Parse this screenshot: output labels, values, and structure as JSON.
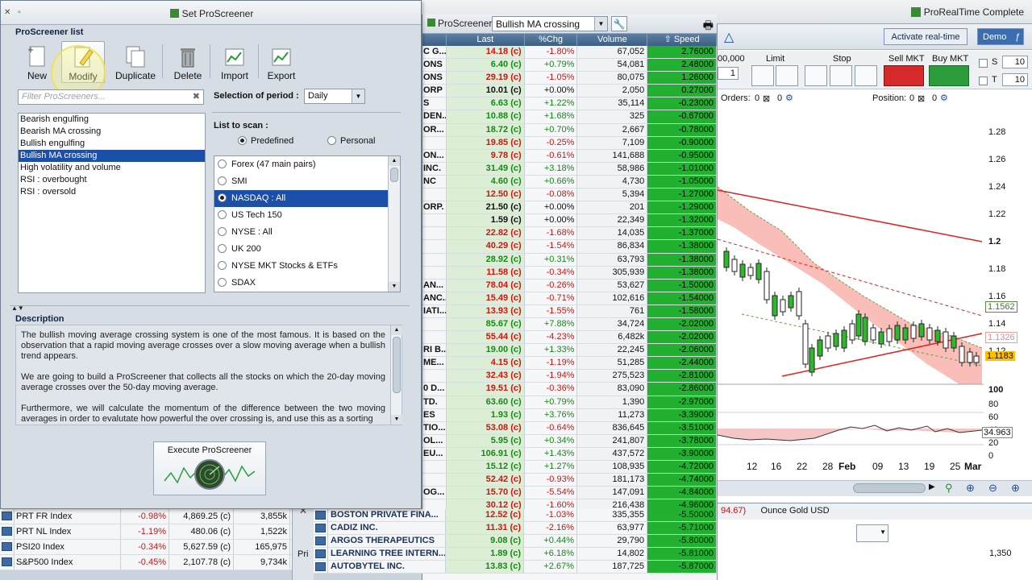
{
  "app": {
    "title": "ProRealTime Complete"
  },
  "dialog": {
    "title": "Set ProScreener",
    "list_section": "ProScreener list",
    "toolbar": [
      {
        "label": "New",
        "icon": "new-document-icon"
      },
      {
        "label": "Modify",
        "icon": "pencil-icon"
      },
      {
        "label": "Duplicate",
        "icon": "duplicate-icon"
      },
      {
        "label": "Delete",
        "icon": "trash-icon"
      },
      {
        "label": "Import",
        "icon": "import-icon"
      },
      {
        "label": "Export",
        "icon": "export-icon"
      }
    ],
    "filter_placeholder": "Filter ProScreeners...",
    "screeners": [
      "Bearish engulfing",
      "Bearish MA crossing",
      "Bullish engulfing",
      "Bullish MA crossing",
      "High volatility and volume",
      "RSI : overbought",
      "RSI : oversold"
    ],
    "selected_screener": "Bullish MA crossing",
    "period_label": "Selection of period :",
    "period_value": "Daily",
    "list_to_scan_label": "List to scan :",
    "scan_type": {
      "predefined": "Predefined",
      "personal": "Personal",
      "selected": "Predefined"
    },
    "scan_lists": [
      "Forex (47 main pairs)",
      "SMI",
      "NASDAQ : All",
      "US Tech 150",
      "NYSE : All",
      "UK 200",
      "NYSE MKT Stocks & ETFs",
      "SDAX"
    ],
    "selected_scan_list": "NASDAQ : All",
    "description_label": "Description",
    "description": [
      "The bullish moving average crossing system is one of the most famous. It is based on the observation that a rapid moving average crosses over a slow moving average when a bullish trend appears.",
      "We are going to build a ProScreener that collects all the stocks on which the 20-day moving average crosses over the 50-day moving average.",
      "Furthermore, we will calculate the momentum of the difference between the two moving averages in order to evalutate how powerful the over crossing is, and use this as a sorting"
    ],
    "execute_label": "Execute ProScreener"
  },
  "results": {
    "title": "ProScreener",
    "screener": "Bullish MA crossing",
    "columns": [
      "Last",
      "%Chg",
      "Volume",
      "Speed"
    ],
    "rows": [
      [
        "C G...",
        "14.18 (c)",
        "-1.80%",
        "67,052",
        "2.76000"
      ],
      [
        "ONS",
        "6.40 (c)",
        "+0.79%",
        "54,081",
        "2.48000"
      ],
      [
        "ONS",
        "29.19 (c)",
        "-1.05%",
        "80,075",
        "1.26000"
      ],
      [
        "ORP",
        "10.01 (c)",
        "+0.00%",
        "2,050",
        "0.27000"
      ],
      [
        "S",
        "6.63 (c)",
        "+1.22%",
        "35,114",
        "-0.23000"
      ],
      [
        "DEN...",
        "10.88 (c)",
        "+1.68%",
        "325",
        "-0.67000"
      ],
      [
        "OR...",
        "18.72 (c)",
        "+0.70%",
        "2,667",
        "-0.78000"
      ],
      [
        "",
        "19.85 (c)",
        "-0.25%",
        "7,109",
        "-0.90000"
      ],
      [
        "ON...",
        "9.78 (c)",
        "-0.61%",
        "141,688",
        "-0.95000"
      ],
      [
        "INC.",
        "31.49 (c)",
        "+3.18%",
        "58,986",
        "-1.01000"
      ],
      [
        "NC",
        "4.60 (c)",
        "+0.66%",
        "4,730",
        "-1.05000"
      ],
      [
        "",
        "12.50 (c)",
        "-0.08%",
        "5,394",
        "-1.27000"
      ],
      [
        "ORP.",
        "21.50 (c)",
        "+0.00%",
        "201",
        "-1.29000"
      ],
      [
        "",
        "1.59 (c)",
        "+0.00%",
        "22,349",
        "-1.32000"
      ],
      [
        "",
        "22.82 (c)",
        "-1.68%",
        "14,035",
        "-1.37000"
      ],
      [
        "",
        "40.29 (c)",
        "-1.54%",
        "86,834",
        "-1.38000"
      ],
      [
        "",
        "28.92 (c)",
        "+0.31%",
        "63,793",
        "-1.38000"
      ],
      [
        "",
        "11.58 (c)",
        "-0.34%",
        "305,939",
        "-1.38000"
      ],
      [
        "AN...",
        "78.04 (c)",
        "-0.26%",
        "53,627",
        "-1.50000"
      ],
      [
        "ANC...",
        "15.49 (c)",
        "-0.71%",
        "102,616",
        "-1.54000"
      ],
      [
        "IATI...",
        "13.93 (c)",
        "-1.55%",
        "761",
        "-1.58000"
      ],
      [
        "",
        "85.67 (c)",
        "+7.88%",
        "34,724",
        "-2.02000"
      ],
      [
        "",
        "55.44 (c)",
        "-4.23%",
        "6,482k",
        "-2.02000"
      ],
      [
        "RI B...",
        "19.00 (c)",
        "+1.33%",
        "22,245",
        "-2.06000"
      ],
      [
        "ME...",
        "4.15 (c)",
        "-1.19%",
        "51,285",
        "-2.44000"
      ],
      [
        "",
        "32.43 (c)",
        "-1.94%",
        "275,523",
        "-2.81000"
      ],
      [
        "0 D...",
        "19.51 (c)",
        "-0.36%",
        "83,090",
        "-2.86000"
      ],
      [
        "TD.",
        "63.60 (c)",
        "+0.79%",
        "1,390",
        "-2.97000"
      ],
      [
        "ES",
        "1.93 (c)",
        "+3.76%",
        "11,273",
        "-3.39000"
      ],
      [
        "TIO...",
        "53.08 (c)",
        "-0.64%",
        "836,645",
        "-3.51000"
      ],
      [
        "OL...",
        "5.95 (c)",
        "+0.34%",
        "241,807",
        "-3.78000"
      ],
      [
        "EU...",
        "106.91 (c)",
        "+1.43%",
        "437,572",
        "-3.90000"
      ],
      [
        "",
        "15.12 (c)",
        "+1.27%",
        "108,935",
        "-4.72000"
      ],
      [
        "",
        "52.42 (c)",
        "-0.93%",
        "181,173",
        "-4.74000"
      ],
      [
        "OG...",
        "15.70 (c)",
        "-5.54%",
        "147,091",
        "-4.84000"
      ],
      [
        "",
        "30.12 (c)",
        "-1.60%",
        "216,438",
        "-4.96000"
      ]
    ],
    "bottom_rows": [
      [
        "BOSTON PRIVATE FINA...",
        "12.52 (c)",
        "-1.03%",
        "335,355",
        "-5.50000"
      ],
      [
        "CADIZ INC.",
        "11.31 (c)",
        "-2.16%",
        "63,977",
        "-5.71000"
      ],
      [
        "ARGOS THERAPEUTICS",
        "9.08 (c)",
        "+0.44%",
        "29,790",
        "-5.80000"
      ],
      [
        "LEARNING TREE INTERN...",
        "1.89 (c)",
        "+6.18%",
        "14,802",
        "-5.81000"
      ],
      [
        "AUTOBYTEL INC.",
        "13.83 (c)",
        "+2.67%",
        "187,725",
        "-5.87000"
      ]
    ]
  },
  "indices": [
    [
      "PRT FR Index",
      "-0.98%",
      "4,869.25 (c)",
      "3,855k"
    ],
    [
      "PRT NL Index",
      "-1.19%",
      "480.06 (c)",
      "1,522k"
    ],
    [
      "PSI20 Index",
      "-0.34%",
      "5,627.59 (c)",
      "165,975"
    ],
    [
      "S&P500 Index",
      "-0.45%",
      "2,107.78 (c)",
      "9,734k"
    ]
  ],
  "midstrip": {
    "label": "Pri"
  },
  "chart": {
    "activate_label": "Activate real-time",
    "demo_label": "Demo",
    "qty": "00,000",
    "qty2": "1",
    "limit_label": "Limit",
    "stop_label": "Stop",
    "sell_label": "Sell MKT",
    "buy_label": "Buy MKT",
    "s_label": "S",
    "t_label": "T",
    "s_value": "10",
    "t_value": "10",
    "orders_label": "Orders:",
    "orders_value": "0",
    "orders_zero": "0",
    "position_label": "Position:",
    "position_value": "0",
    "position_zero": "0",
    "y_ticks": [
      "1.28",
      "1.26",
      "1.24",
      "1.22",
      "1.2",
      "1.18",
      "1.16",
      "1.14",
      "1.12"
    ],
    "price_tags": [
      "1.1562",
      "1.1326",
      "1.1183"
    ],
    "osc_ticks": [
      "100",
      "80",
      "60",
      "40",
      "20",
      "0"
    ],
    "osc_value": "34.963",
    "x_ticks": [
      "12",
      "16",
      "22",
      "28",
      "Feb",
      "09",
      "13",
      "19",
      "25",
      "Mar"
    ],
    "lower_instrument": "Ounce Gold USD",
    "lower_value": "94.67)",
    "lower_tick": "1,350"
  }
}
